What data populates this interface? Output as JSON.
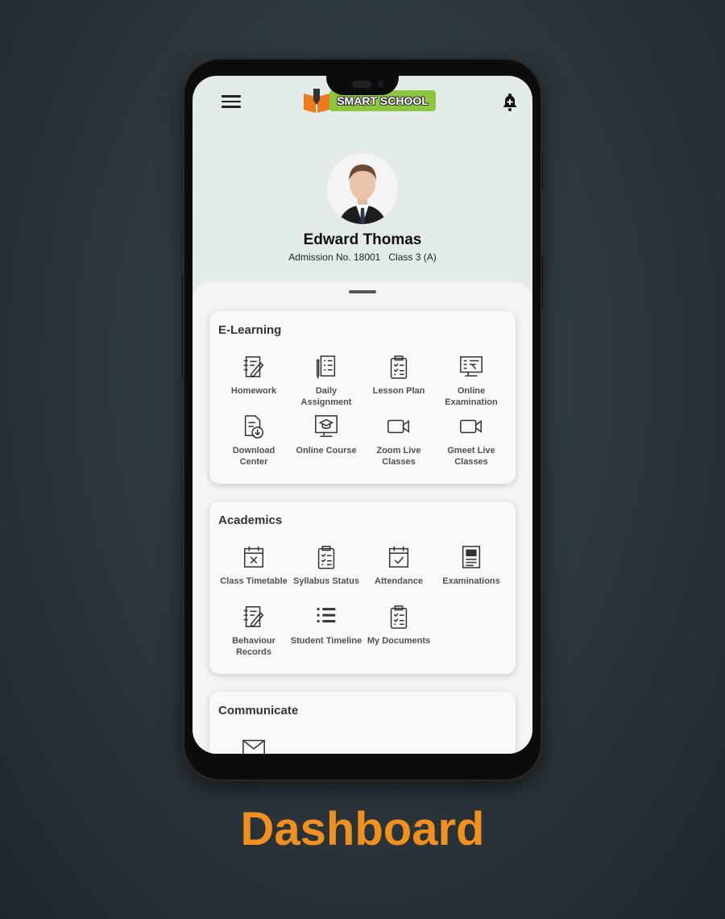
{
  "header": {
    "logo_text": "SMART SCHOOL",
    "menu_icon": "hamburger-icon",
    "notification_icon": "bell-plus-icon"
  },
  "profile": {
    "name": "Edward Thomas",
    "admission": "Admission No. 18001",
    "class": "Class 3 (A)"
  },
  "sections": [
    {
      "title": "E-Learning",
      "items": [
        {
          "label": "Homework",
          "icon": "notebook-pen-icon"
        },
        {
          "label": "Daily Assignment",
          "icon": "checklist-icon"
        },
        {
          "label": "Lesson Plan",
          "icon": "clipboard-icon"
        },
        {
          "label": "Online Examination",
          "icon": "monitor-exam-icon"
        },
        {
          "label": "Download Center",
          "icon": "file-download-icon"
        },
        {
          "label": "Online Course",
          "icon": "monitor-graduation-icon"
        },
        {
          "label": "Zoom Live Classes",
          "icon": "video-camera-icon"
        },
        {
          "label": "Gmeet Live Classes",
          "icon": "video-camera-icon"
        }
      ]
    },
    {
      "title": "Academics",
      "items": [
        {
          "label": "Class Timetable",
          "icon": "calendar-x-icon"
        },
        {
          "label": "Syllabus Status",
          "icon": "clipboard-icon"
        },
        {
          "label": "Attendance",
          "icon": "calendar-check-icon"
        },
        {
          "label": "Examinations",
          "icon": "grade-report-icon"
        },
        {
          "label": "Behaviour Records",
          "icon": "notebook-pen-icon"
        },
        {
          "label": "Student Timeline",
          "icon": "list-icon"
        },
        {
          "label": "My Documents",
          "icon": "clipboard-icon"
        }
      ]
    },
    {
      "title": "Communicate",
      "items": [
        {
          "label": "",
          "icon": "mail-icon"
        }
      ]
    }
  ],
  "caption": "Dashboard",
  "colors": {
    "accent": "#f0901e",
    "logo_green": "#8cc63f",
    "header_bg": "#e2ebe7"
  }
}
